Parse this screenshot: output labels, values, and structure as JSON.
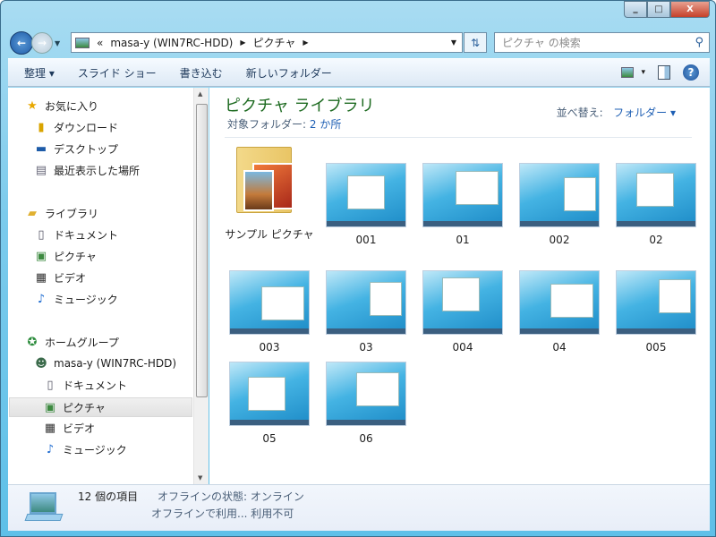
{
  "window": {
    "minimize": "‗",
    "maximize": "□",
    "close": "X"
  },
  "address": {
    "chevron": "«",
    "segments": [
      "masa-y (WIN7RC-HDD)",
      "ピクチャ"
    ]
  },
  "search": {
    "placeholder": "ピクチャ の検索"
  },
  "toolbar": {
    "organize": "整理 ▾",
    "slideshow": "スライド ショー",
    "burn": "書き込む",
    "new_folder": "新しいフォルダー",
    "view": "▾",
    "help": "?"
  },
  "nav": {
    "favorites": "お気に入り",
    "downloads": "ダウンロード",
    "desktop": "デスクトップ",
    "recent": "最近表示した場所",
    "libraries": "ライブラリ",
    "documents": "ドキュメント",
    "pictures": "ピクチャ",
    "videos": "ビデオ",
    "music": "ミュージック",
    "homegroup": "ホームグループ",
    "user": "masa-y (WIN7RC-HDD)",
    "hg_documents": "ドキュメント",
    "hg_pictures": "ピクチャ",
    "hg_videos": "ビデオ",
    "hg_music": "ミュージック"
  },
  "library": {
    "title": "ピクチャ ライブラリ",
    "subtitle_label": "対象フォルダー:",
    "subtitle_link": "2 か所",
    "sort_label": "並べ替え:",
    "sort_value": "フォルダー ▾"
  },
  "items": [
    "サンプル ピクチャ",
    "001",
    "01",
    "002",
    "02",
    "003",
    "03",
    "004",
    "04",
    "005",
    "05",
    "06"
  ],
  "status": {
    "count": "12 個の項目",
    "offline_status": "オフラインの状態: オンライン",
    "offline_avail": "オフラインで利用... 利用不可"
  }
}
